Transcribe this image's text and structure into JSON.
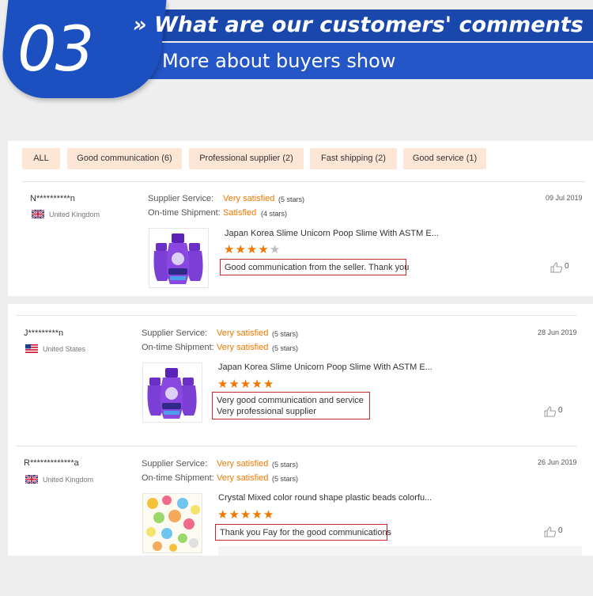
{
  "banner": {
    "number": "03",
    "title": "» What are our customers' comments ?",
    "subtitle": "More about buyers show",
    "brand_color": "#1c4fbf"
  },
  "filters": [
    {
      "label": "ALL"
    },
    {
      "label": "Good communication (6)"
    },
    {
      "label": "Professional supplier (2)"
    },
    {
      "label": "Fast shipping (2)"
    },
    {
      "label": "Good service (1)"
    }
  ],
  "labels": {
    "supplier_service": "Supplier Service:",
    "ontime_shipment": "On-time Shipment:"
  },
  "colors": {
    "accent": "#f07800",
    "chip_bg": "#fde6d6",
    "highlight_border": "#c42a2a"
  },
  "reviews": [
    {
      "name": "N**********n",
      "country": "United Kingdom",
      "flag": "uk-flag-icon",
      "supplier_value": "Very satisfied",
      "supplier_stars": "(5 stars)",
      "shipment_value": "Satisfied",
      "shipment_stars": "(4 stars)",
      "date": "09 Jul 2019",
      "product": "Japan Korea Slime Unicorn Poop Slime With ASTM E...",
      "rating": 4,
      "comment": [
        "Good communication from the seller. Thank you"
      ],
      "likes": "0"
    },
    {
      "name": "J*********n",
      "country": "United States",
      "flag": "us-flag-icon",
      "supplier_value": "Very satisfied",
      "supplier_stars": "(5 stars)",
      "shipment_value": "Very satisfied",
      "shipment_stars": "(5 stars)",
      "date": "28 Jun 2019",
      "product": "Japan Korea Slime Unicorn Poop Slime With ASTM E...",
      "rating": 5,
      "comment": [
        "Very good communication and service",
        "Very professional supplier"
      ],
      "likes": "0"
    },
    {
      "name": "R*************a",
      "country": "United Kingdom",
      "flag": "uk-flag-icon",
      "supplier_value": "Very satisfied",
      "supplier_stars": "(5 stars)",
      "shipment_value": "Very satisfied",
      "shipment_stars": "(5 stars)",
      "date": "26 Jun 2019",
      "product": "Crystal Mixed color round shape plastic beads colorfu...",
      "rating": 5,
      "comment": [
        "Thank you Fay for the good communications"
      ],
      "likes": "0"
    }
  ]
}
